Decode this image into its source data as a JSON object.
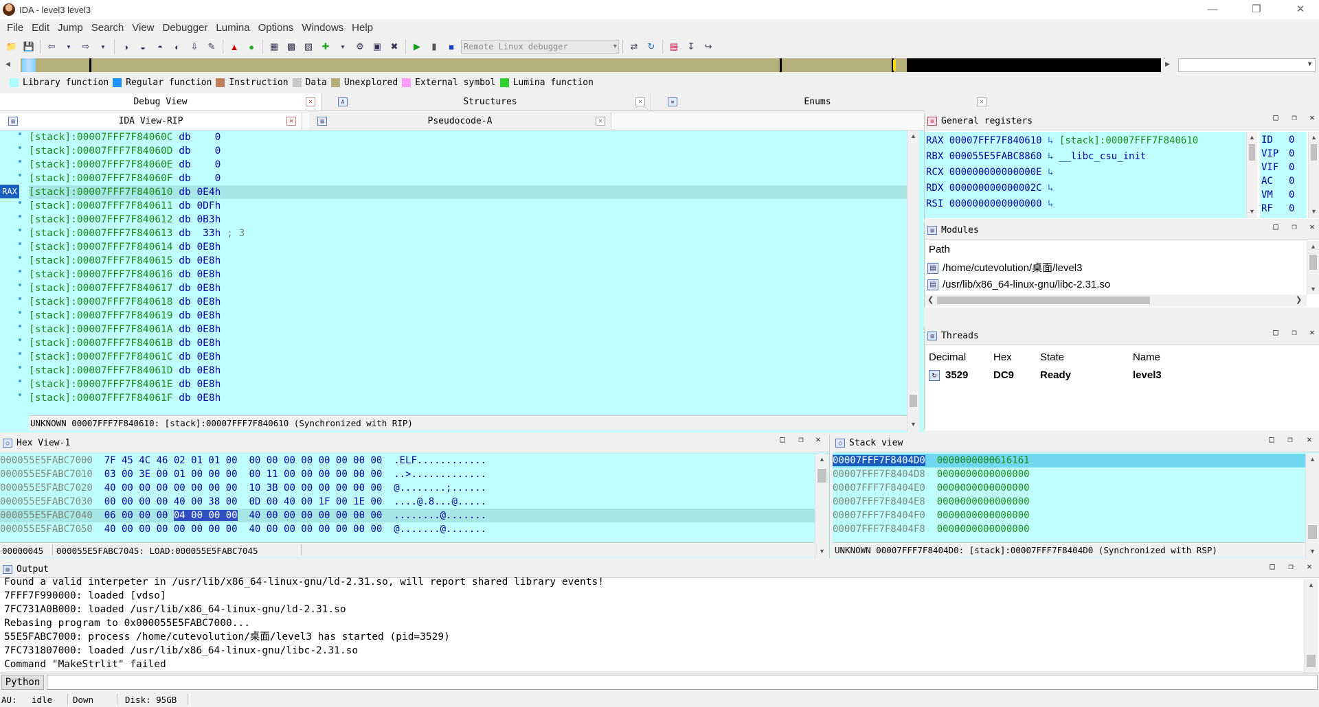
{
  "window": {
    "title": "IDA - level3 level3"
  },
  "menu": [
    "File",
    "Edit",
    "Jump",
    "Search",
    "View",
    "Debugger",
    "Lumina",
    "Options",
    "Windows",
    "Help"
  ],
  "toolbar": {
    "debugger_select": "Remote Linux debugger"
  },
  "legend": [
    {
      "label": "Library function",
      "color": "#b0ffff"
    },
    {
      "label": "Regular function",
      "color": "#1e90ff"
    },
    {
      "label": "Instruction",
      "color": "#c08060"
    },
    {
      "label": "Data",
      "color": "#c8c8c8"
    },
    {
      "label": "Unexplored",
      "color": "#b5b07a"
    },
    {
      "label": "External symbol",
      "color": "#ff9dff"
    },
    {
      "label": "Lumina function",
      "color": "#30d030"
    }
  ],
  "top_tabs": {
    "debug_view": "Debug View",
    "structures": "Structures",
    "enums": "Enums"
  },
  "sub_tabs": {
    "ida_view": "IDA View-RIP",
    "pseudocode": "Pseudocode-A"
  },
  "ida_view": {
    "rax_marker": "RAX",
    "lines": [
      {
        "addr": "[stack]:00007FFF7F84060C",
        "op": "db",
        "val": "   0",
        "cmt": ""
      },
      {
        "addr": "[stack]:00007FFF7F84060D",
        "op": "db",
        "val": "   0",
        "cmt": ""
      },
      {
        "addr": "[stack]:00007FFF7F84060E",
        "op": "db",
        "val": "   0",
        "cmt": ""
      },
      {
        "addr": "[stack]:00007FFF7F84060F",
        "op": "db",
        "val": "   0",
        "cmt": ""
      },
      {
        "addr": "[stack]:00007FFF7F840610",
        "op": "db",
        "val": "0E4h",
        "cmt": ""
      },
      {
        "addr": "[stack]:00007FFF7F840611",
        "op": "db",
        "val": "0DFh",
        "cmt": ""
      },
      {
        "addr": "[stack]:00007FFF7F840612",
        "op": "db",
        "val": "0B3h",
        "cmt": ""
      },
      {
        "addr": "[stack]:00007FFF7F840613",
        "op": "db",
        "val": " 33h",
        "cmt": " ; 3"
      },
      {
        "addr": "[stack]:00007FFF7F840614",
        "op": "db",
        "val": "0E8h",
        "cmt": ""
      },
      {
        "addr": "[stack]:00007FFF7F840615",
        "op": "db",
        "val": "0E8h",
        "cmt": ""
      },
      {
        "addr": "[stack]:00007FFF7F840616",
        "op": "db",
        "val": "0E8h",
        "cmt": ""
      },
      {
        "addr": "[stack]:00007FFF7F840617",
        "op": "db",
        "val": "0E8h",
        "cmt": ""
      },
      {
        "addr": "[stack]:00007FFF7F840618",
        "op": "db",
        "val": "0E8h",
        "cmt": ""
      },
      {
        "addr": "[stack]:00007FFF7F840619",
        "op": "db",
        "val": "0E8h",
        "cmt": ""
      },
      {
        "addr": "[stack]:00007FFF7F84061A",
        "op": "db",
        "val": "0E8h",
        "cmt": ""
      },
      {
        "addr": "[stack]:00007FFF7F84061B",
        "op": "db",
        "val": "0E8h",
        "cmt": ""
      },
      {
        "addr": "[stack]:00007FFF7F84061C",
        "op": "db",
        "val": "0E8h",
        "cmt": ""
      },
      {
        "addr": "[stack]:00007FFF7F84061D",
        "op": "db",
        "val": "0E8h",
        "cmt": ""
      },
      {
        "addr": "[stack]:00007FFF7F84061E",
        "op": "db",
        "val": "0E8h",
        "cmt": ""
      },
      {
        "addr": "[stack]:00007FFF7F84061F",
        "op": "db",
        "val": "0E8h",
        "cmt": ""
      }
    ],
    "status": "UNKNOWN 00007FFF7F840610: [stack]:00007FFF7F840610 (Synchronized with RIP)"
  },
  "registers": {
    "title": "General registers",
    "rows": [
      {
        "name": "RAX",
        "value": "00007FFF7F840610",
        "ref": "[stack]:00007FFF7F840610"
      },
      {
        "name": "RBX",
        "value": "000055E5FABC8860",
        "ref": "__libc_csu_init"
      },
      {
        "name": "RCX",
        "value": "000000000000000E",
        "ref": ""
      },
      {
        "name": "RDX",
        "value": "000000000000002C",
        "ref": ""
      },
      {
        "name": "RSI",
        "value": "0000000000000000",
        "ref": ""
      }
    ],
    "flags": [
      {
        "n": "ID",
        "v": "0"
      },
      {
        "n": "VIP",
        "v": "0"
      },
      {
        "n": "VIF",
        "v": "0"
      },
      {
        "n": "AC",
        "v": "0"
      },
      {
        "n": "VM",
        "v": "0"
      },
      {
        "n": "RF",
        "v": "0"
      }
    ]
  },
  "modules": {
    "title": "Modules",
    "header": "Path",
    "rows": [
      "/home/cutevolution/桌面/level3",
      "/usr/lib/x86_64-linux-gnu/libc-2.31.so"
    ]
  },
  "threads": {
    "title": "Threads",
    "headers": [
      "Decimal",
      "Hex",
      "State",
      "Name"
    ],
    "row": [
      "3529",
      "DC9",
      "Ready",
      "level3"
    ]
  },
  "hex_view": {
    "title": "Hex View-1",
    "rows": [
      {
        "addr": "000055E5FABC7000",
        "bytes1": "7F 45 4C 46 02 01 01 00",
        "bytes2": "00 00 00 00 00 00 00 00",
        "ascii": ".ELF............"
      },
      {
        "addr": "000055E5FABC7010",
        "bytes1": "03 00 3E 00 01 00 00 00",
        "bytes2": "00 11 00 00 00 00 00 00",
        "ascii": "..>............."
      },
      {
        "addr": "000055E5FABC7020",
        "bytes1": "40 00 00 00 00 00 00 00",
        "bytes2": "10 3B 00 00 00 00 00 00",
        "ascii": "@........;......"
      },
      {
        "addr": "000055E5FABC7030",
        "bytes1": "00 00 00 00 40 00 38 00",
        "bytes2": "0D 00 40 00 1F 00 1E 00",
        "ascii": "....@.8...@....."
      },
      {
        "addr": "000055E5FABC7040",
        "bytes1a": "06 00 00 00 ",
        "bytes1b": "04 00 00 00",
        "bytes2": "40 00 00 00 00 00 00 00",
        "ascii": "........@......."
      },
      {
        "addr": "000055E5FABC7050",
        "bytes1": "40 00 00 00 00 00 00 00",
        "bytes2": "40 00 00 00 00 00 00 00",
        "ascii": "@.......@......."
      }
    ],
    "status1": "00000045",
    "status2": "000055E5FABC7045: LOAD:000055E5FABC7045"
  },
  "stack_view": {
    "title": "Stack view",
    "rows": [
      {
        "addr": "00007FFF7F8404D0",
        "val": "0000000000616161"
      },
      {
        "addr": "00007FFF7F8404D8",
        "val": "0000000000000000"
      },
      {
        "addr": "00007FFF7F8404E0",
        "val": "0000000000000000"
      },
      {
        "addr": "00007FFF7F8404E8",
        "val": "0000000000000000"
      },
      {
        "addr": "00007FFF7F8404F0",
        "val": "0000000000000000"
      },
      {
        "addr": "00007FFF7F8404F8",
        "val": "0000000000000000"
      }
    ],
    "status": "UNKNOWN 00007FFF7F8404D0: [stack]:00007FFF7F8404D0 (Synchronized with RSP)"
  },
  "output": {
    "title": "Output",
    "lines": [
      "Found a valid interpeter in /usr/lib/x86_64-linux-gnu/ld-2.31.so, will report shared library events!",
      "7FFF7F990000: loaded [vdso]",
      "7FC731A0B000: loaded /usr/lib/x86_64-linux-gnu/ld-2.31.so",
      "Rebasing program to 0x000055E5FABC7000...",
      "55E5FABC7000: process /home/cutevolution/桌面/level3 has started (pid=3529)",
      "7FC731807000: loaded /usr/lib/x86_64-linux-gnu/libc-2.31.so",
      "Command \"MakeStrlit\" failed"
    ]
  },
  "python_btn": "Python",
  "statusbar": {
    "au": "AU:",
    "state": "idle",
    "down": "Down",
    "disk": "Disk: 95GB"
  }
}
